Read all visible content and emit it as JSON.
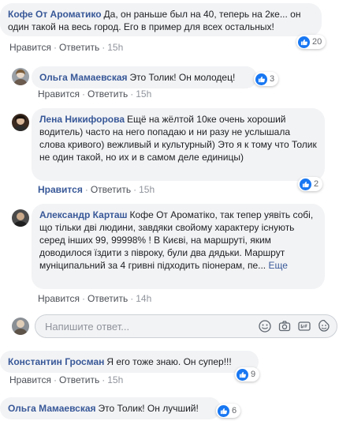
{
  "comments": [
    {
      "author": "Кофе От Ароматико",
      "text": "Да, он раньше был на 40, теперь на 2ке... он один такой на весь город. Его в пример для всех остальных!",
      "like": "Нравится",
      "reply": "Ответить",
      "time": "15h",
      "reactions": "20"
    },
    {
      "author": "Ольга Мамаевская",
      "text": "Это Толик! Он молодец!",
      "like": "Нравится",
      "reply": "Ответить",
      "time": "15h",
      "reactions": "3"
    },
    {
      "author": "Лена Никифорова",
      "text": "Ещё на жёлтой 10ке очень хороший водитель) часто на него попадаю и ни разу не услышала слова кривого) вежливый и культурный) Это я к тому что Толик не один такой, но их и в самом деле единицы)",
      "like": "Нравится",
      "reply": "Ответить",
      "time": "15h",
      "reactions": "2"
    },
    {
      "author": "Александр Карташ",
      "text": "Кофе От Ароматіко, так тепер уявіть собі, що тільки дві людини, завдяки свойому характеру існують серед інших 99, 99998% ! В Києві, на маршруті, яким доводилося їздити з півроку, були два дядьки. Маршрут муніципальний за 4 гривні підходить пiонерам, пе...",
      "more": "Еще",
      "like": "Нравится",
      "reply": "Ответить",
      "time": "14h"
    },
    {
      "author": "Константин Гросман",
      "text": "Я его тоже знаю. Он супер!!!",
      "like": "Нравится",
      "reply": "Ответить",
      "time": "15h",
      "reactions": "9"
    },
    {
      "author": "Ольга Мамаевская",
      "text": "Это Толик! Он лучший!",
      "reactions": "6"
    }
  ],
  "reply_box": {
    "placeholder": "Напишите ответ..."
  },
  "sep": "·"
}
